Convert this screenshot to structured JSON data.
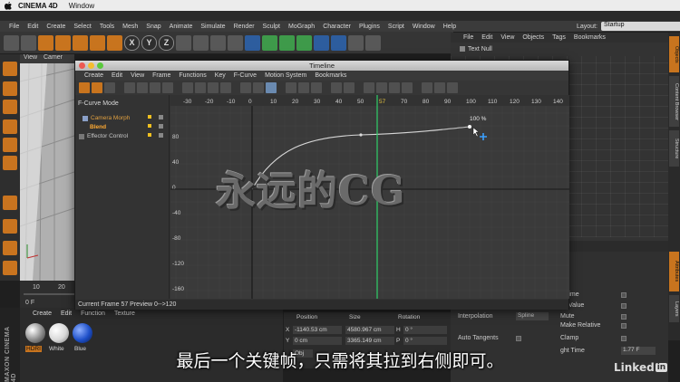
{
  "mac_menu": {
    "app": "CINEMA 4D",
    "items": [
      "Window"
    ]
  },
  "c4d_menu": [
    "File",
    "Edit",
    "Create",
    "Select",
    "Tools",
    "Mesh",
    "Snap",
    "Animate",
    "Simulate",
    "Render",
    "Sculpt",
    "MoGraph",
    "Character",
    "Plugins",
    "Script",
    "Window",
    "Help"
  ],
  "layout": {
    "label": "Layout:",
    "value": "Startup"
  },
  "toolbar": {
    "axes": [
      "X",
      "Y",
      "Z"
    ]
  },
  "viewport": {
    "tabs": [
      "View",
      "Camer"
    ]
  },
  "object_manager": {
    "menu": [
      "File",
      "Edit",
      "View",
      "Objects",
      "Tags",
      "Bookmarks"
    ],
    "objects": [
      "Text Null"
    ]
  },
  "timeline": {
    "title": "Timeline",
    "menu": [
      "Create",
      "Edit",
      "View",
      "Frame",
      "Functions",
      "Key",
      "F-Curve",
      "Motion System",
      "Bookmarks"
    ],
    "mode_label": "F-Curve Mode",
    "tracks": [
      {
        "label": "Camera Morph",
        "color": "#e0a040"
      },
      {
        "label": "Blend",
        "color": "#ffaa33"
      },
      {
        "label": "Effector Control",
        "color": "#d8d8d8"
      }
    ],
    "ruler": [
      "-30",
      "-20",
      "-10",
      "0",
      "10",
      "20",
      "30",
      "40",
      "50",
      "57",
      "70",
      "80",
      "90",
      "100",
      "110",
      "120",
      "130",
      "140"
    ],
    "y_labels": [
      "80",
      "40",
      "0",
      "-40",
      "-80",
      "-120",
      "-160"
    ],
    "key_label": "100 %",
    "status": "Current Frame  57  Preview  0-->120"
  },
  "anim": {
    "ticks": [
      "10",
      "20"
    ],
    "frame": "0 F"
  },
  "materials": {
    "menu": [
      "Create",
      "Edit",
      "Function",
      "Texture"
    ],
    "items": [
      {
        "label": "HDRI",
        "color": "#c8c8c8"
      },
      {
        "label": "White",
        "color": "#f0f0f0"
      },
      {
        "label": "Blue",
        "color": "#1d4fc8"
      }
    ]
  },
  "coords": {
    "headers": [
      "Position",
      "Size",
      "Rotation"
    ],
    "rows": [
      {
        "axis": "X",
        "pos": "-1140.53 cm",
        "size": "4580.967 cm",
        "rot_axis": "H",
        "rot": "0 °"
      },
      {
        "axis": "Y",
        "pos": "0 cm",
        "size": "3365.149 cm",
        "rot_axis": "P",
        "rot": "0 °"
      }
    ],
    "button": "Obj"
  },
  "attributes": {
    "interpolation_label": "Interpolation",
    "interpolation_value": "Spline",
    "auto_tangents": "Auto Tangents",
    "props": [
      "k Time",
      "ck Value",
      "Mute",
      "Make Relative",
      "Clamp",
      "ght Time"
    ],
    "right_time_value": "1.77 F"
  },
  "side_tabs": [
    "Objects",
    "Content Browser",
    "Structure",
    "Attributes",
    "Layers"
  ],
  "brand": "MAXON CINEMA 4D",
  "watermark": "永远的CG",
  "subtitle": "最后一个关键帧，只需将其拉到右侧即可。",
  "logo": "Linked"
}
